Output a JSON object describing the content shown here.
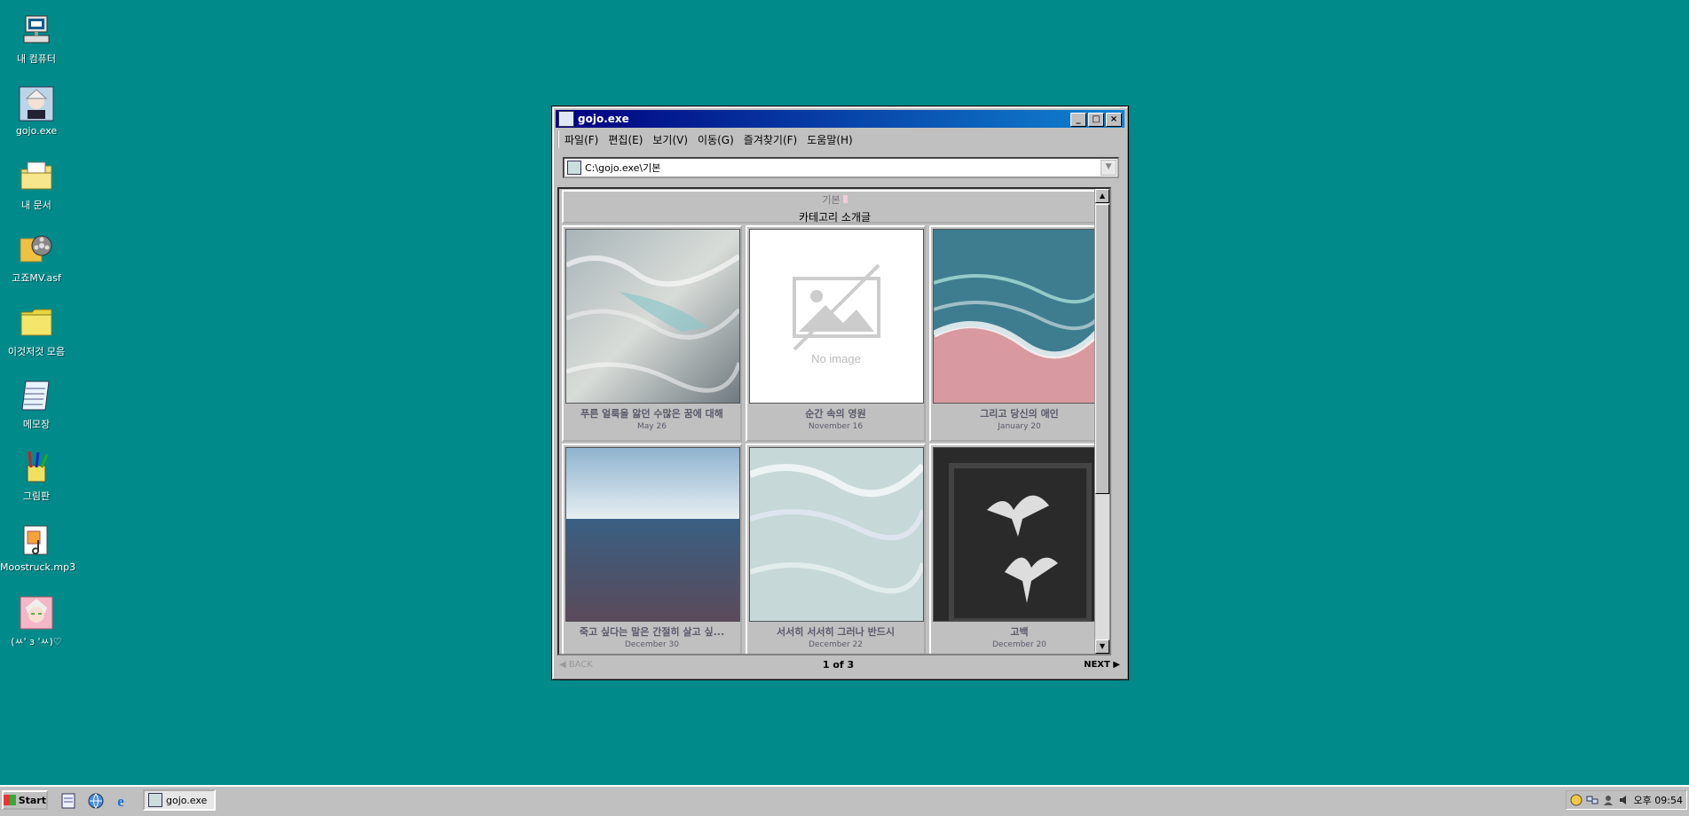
{
  "desktop": {
    "icons": [
      {
        "label": "내 컴퓨터",
        "icon": "computer-icon"
      },
      {
        "label": "gojo.exe",
        "icon": "gojo-app-icon"
      },
      {
        "label": "내 문서",
        "icon": "documents-folder-icon"
      },
      {
        "label": "고죠MV.asf",
        "icon": "video-file-icon"
      },
      {
        "label": "이것저것 모음",
        "icon": "folder-icon"
      },
      {
        "label": "메모장",
        "icon": "notepad-icon"
      },
      {
        "label": "그림판",
        "icon": "paint-icon"
      },
      {
        "label": "Moostruck.mp3",
        "icon": "audio-file-icon"
      },
      {
        "label": "(ㅆ' з 'ㅆ)♡",
        "icon": "avatar-image-icon"
      }
    ]
  },
  "window": {
    "title": "gojo.exe",
    "menu": [
      "파일(F)",
      "편집(E)",
      "보기(V)",
      "이동(G)",
      "즐겨찾기(F)",
      "도움말(H)"
    ],
    "address": "C:\\gojo.exe\\기본",
    "category": {
      "title": "기본",
      "description": "카테고리 소개글"
    },
    "posts": [
      {
        "title": "푸른 얼룩을 앓던 수많은 꿈에 대해",
        "date": "May 26",
        "image": "water-caustics"
      },
      {
        "title": "순간 속의 영원",
        "date": "November 16",
        "image": "No image"
      },
      {
        "title": "그리고 당신의 애인",
        "date": "January 20",
        "image": "waves-pink-sand"
      },
      {
        "title": "죽고 싶다는 말은 간절히 살고 싶...",
        "date": "December 30",
        "image": "ocean-horizon"
      },
      {
        "title": "서서히 서서히 그러나 반드시",
        "date": "December 22",
        "image": "shallow-sea"
      },
      {
        "title": "고백",
        "date": "December 20",
        "image": "doves"
      }
    ],
    "pagination": {
      "back": "◀ BACK",
      "current": "1 of 3",
      "next": "NEXT ▶"
    }
  },
  "taskbar": {
    "start": "Start",
    "task": "gojo.exe",
    "clock": "오후 09:54"
  },
  "colors": {
    "desktop": "#008a8a",
    "titlebar_start": "#000080",
    "titlebar_end": "#1084d0"
  }
}
